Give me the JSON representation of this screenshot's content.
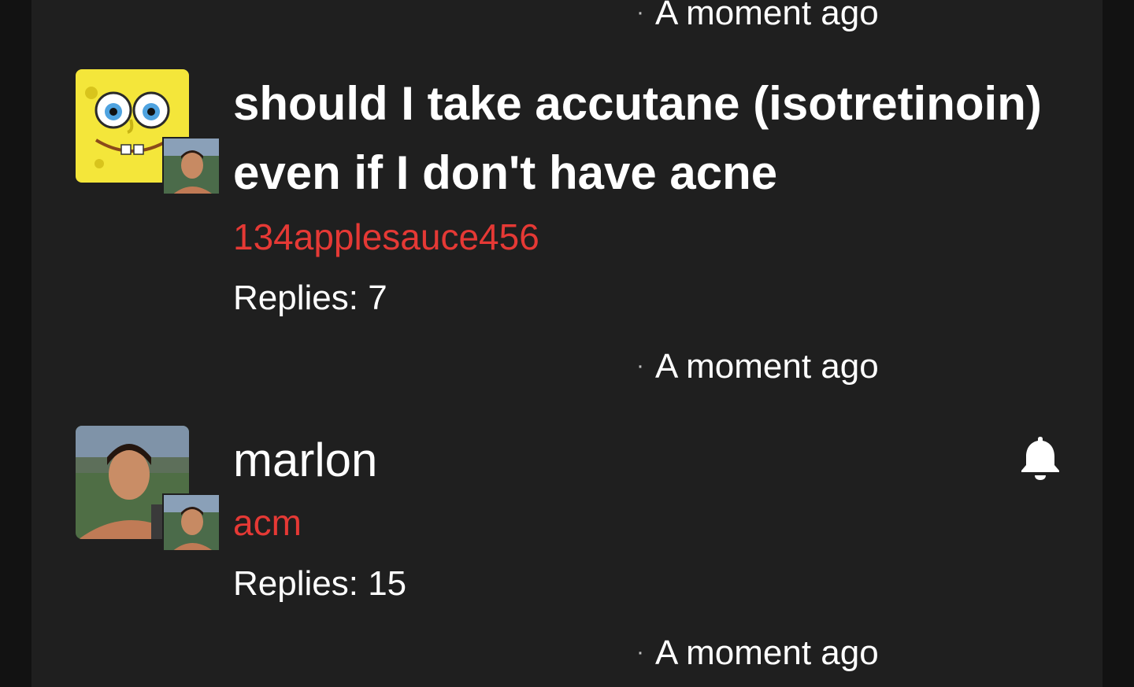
{
  "threads": [
    {
      "title": "should I take accutane (isotretinoin) even if I don't have acne",
      "author": "134applesauce456",
      "replies_label": "Replies: 7",
      "timestamp": "A moment ago",
      "avatar_icon": "cartoon-face-avatar-icon",
      "badge_icon": "user-photo-avatar-icon"
    },
    {
      "title": "marlon",
      "author": "acm",
      "replies_label": "Replies: 15",
      "timestamp": "A moment ago",
      "avatar_icon": "user-photo-avatar-icon",
      "badge_icon": "user-photo-avatar-icon",
      "notification_icon": "bell-icon"
    }
  ],
  "top_timestamp": "A moment ago",
  "colors": {
    "background": "#1f1f1f",
    "outer": "#121212",
    "text": "#ffffff",
    "author": "#e53935"
  }
}
